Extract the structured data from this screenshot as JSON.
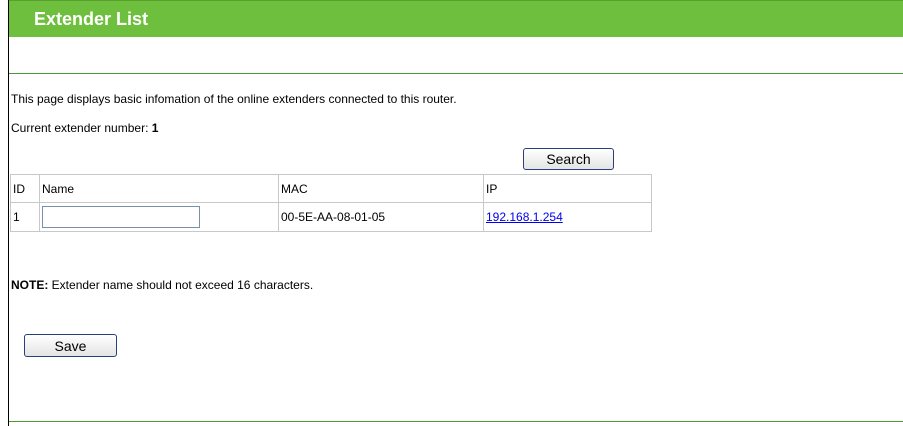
{
  "header": {
    "title": "Extender List"
  },
  "intro_text": "This page displays basic infomation of the online extenders connected to this router.",
  "current": {
    "label": "Current extender number:",
    "value": "1"
  },
  "search_label": "Search",
  "table": {
    "headers": {
      "id": "ID",
      "name": "Name",
      "mac": "MAC",
      "ip": "IP"
    },
    "rows": [
      {
        "id": "1",
        "name": "",
        "mac": "00-5E-AA-08-01-05",
        "ip": "192.168.1.254"
      }
    ]
  },
  "note": {
    "label": "NOTE:",
    "text": " Extender name should not exceed 16 characters."
  },
  "save_label": "Save",
  "colors": {
    "header_green": "#6fbf3f",
    "divider_green": "#4a9a3a",
    "link_blue": "#0000ee"
  }
}
